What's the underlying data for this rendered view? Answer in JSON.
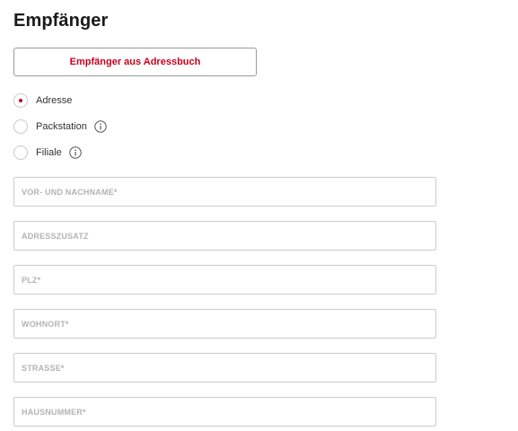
{
  "page": {
    "title": "Empfänger"
  },
  "addressbook_button": {
    "label": "Empfänger aus Adressbuch"
  },
  "recipient_type": {
    "options": [
      {
        "label": "Adresse",
        "selected": true,
        "info_icon": ""
      },
      {
        "label": "Packstation",
        "selected": false,
        "info_icon": "info-circle-icon"
      },
      {
        "label": "Filiale",
        "selected": false,
        "info_icon": "info-circle-icon"
      }
    ]
  },
  "form": {
    "fields": [
      {
        "placeholder": "VOR- UND NACHNAME*",
        "value": ""
      },
      {
        "placeholder": "ADRESSZUSATZ",
        "value": ""
      },
      {
        "placeholder": "PLZ*",
        "value": ""
      },
      {
        "placeholder": "WOHNORT*",
        "value": ""
      },
      {
        "placeholder": "STRASSE*",
        "value": ""
      },
      {
        "placeholder": "HAUSNUMMER*",
        "value": ""
      }
    ]
  },
  "colors": {
    "accent": "#c8001e",
    "border": "#cccccc",
    "placeholder": "#b3b3b3",
    "title": "#1a1a1a"
  }
}
